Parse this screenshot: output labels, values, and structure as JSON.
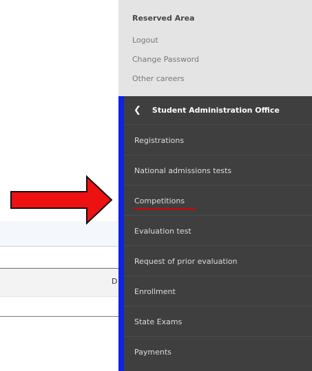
{
  "reserved_area": {
    "title": "Reserved Area",
    "links": [
      "Logout",
      "Change Password",
      "Other careers"
    ]
  },
  "office_menu": {
    "header": "Student Administration Office",
    "items": [
      "Registrations",
      "National admissions tests",
      "Competitions",
      "Evaluation test",
      "Request of prior evaluation",
      "Enrollment",
      "State Exams",
      "Payments"
    ]
  },
  "background": {
    "table_header_letter": "D"
  },
  "colors": {
    "arrow_fill": "#ee1111",
    "accent_bar": "#0d24e0",
    "menu_bg": "#3f3f3f"
  }
}
